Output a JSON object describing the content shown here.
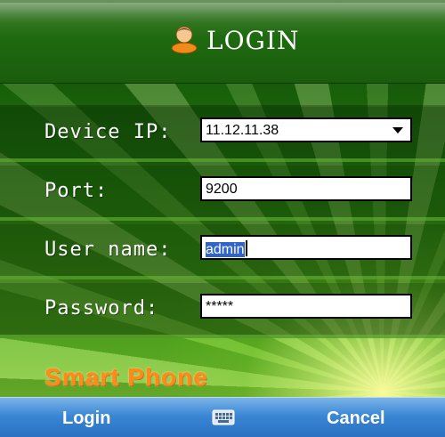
{
  "title": {
    "text": "LOGIN",
    "icon": "user-icon"
  },
  "fields": [
    {
      "label": "Device IP:",
      "value": "11.12.11.38",
      "type": "select"
    },
    {
      "label": "Port:",
      "value": "9200",
      "type": "text"
    },
    {
      "label": "User name:",
      "value": "admin",
      "type": "text"
    },
    {
      "label": "Password:",
      "value": "*****",
      "type": "password"
    }
  ],
  "brand": "Smart Phone",
  "softkeys": {
    "left": "Login",
    "center_icon": "keyboard-icon",
    "right": "Cancel"
  },
  "colors": {
    "accent": "#ff8a1a",
    "softbar": "#3a86d4",
    "background": "#2a8410"
  }
}
